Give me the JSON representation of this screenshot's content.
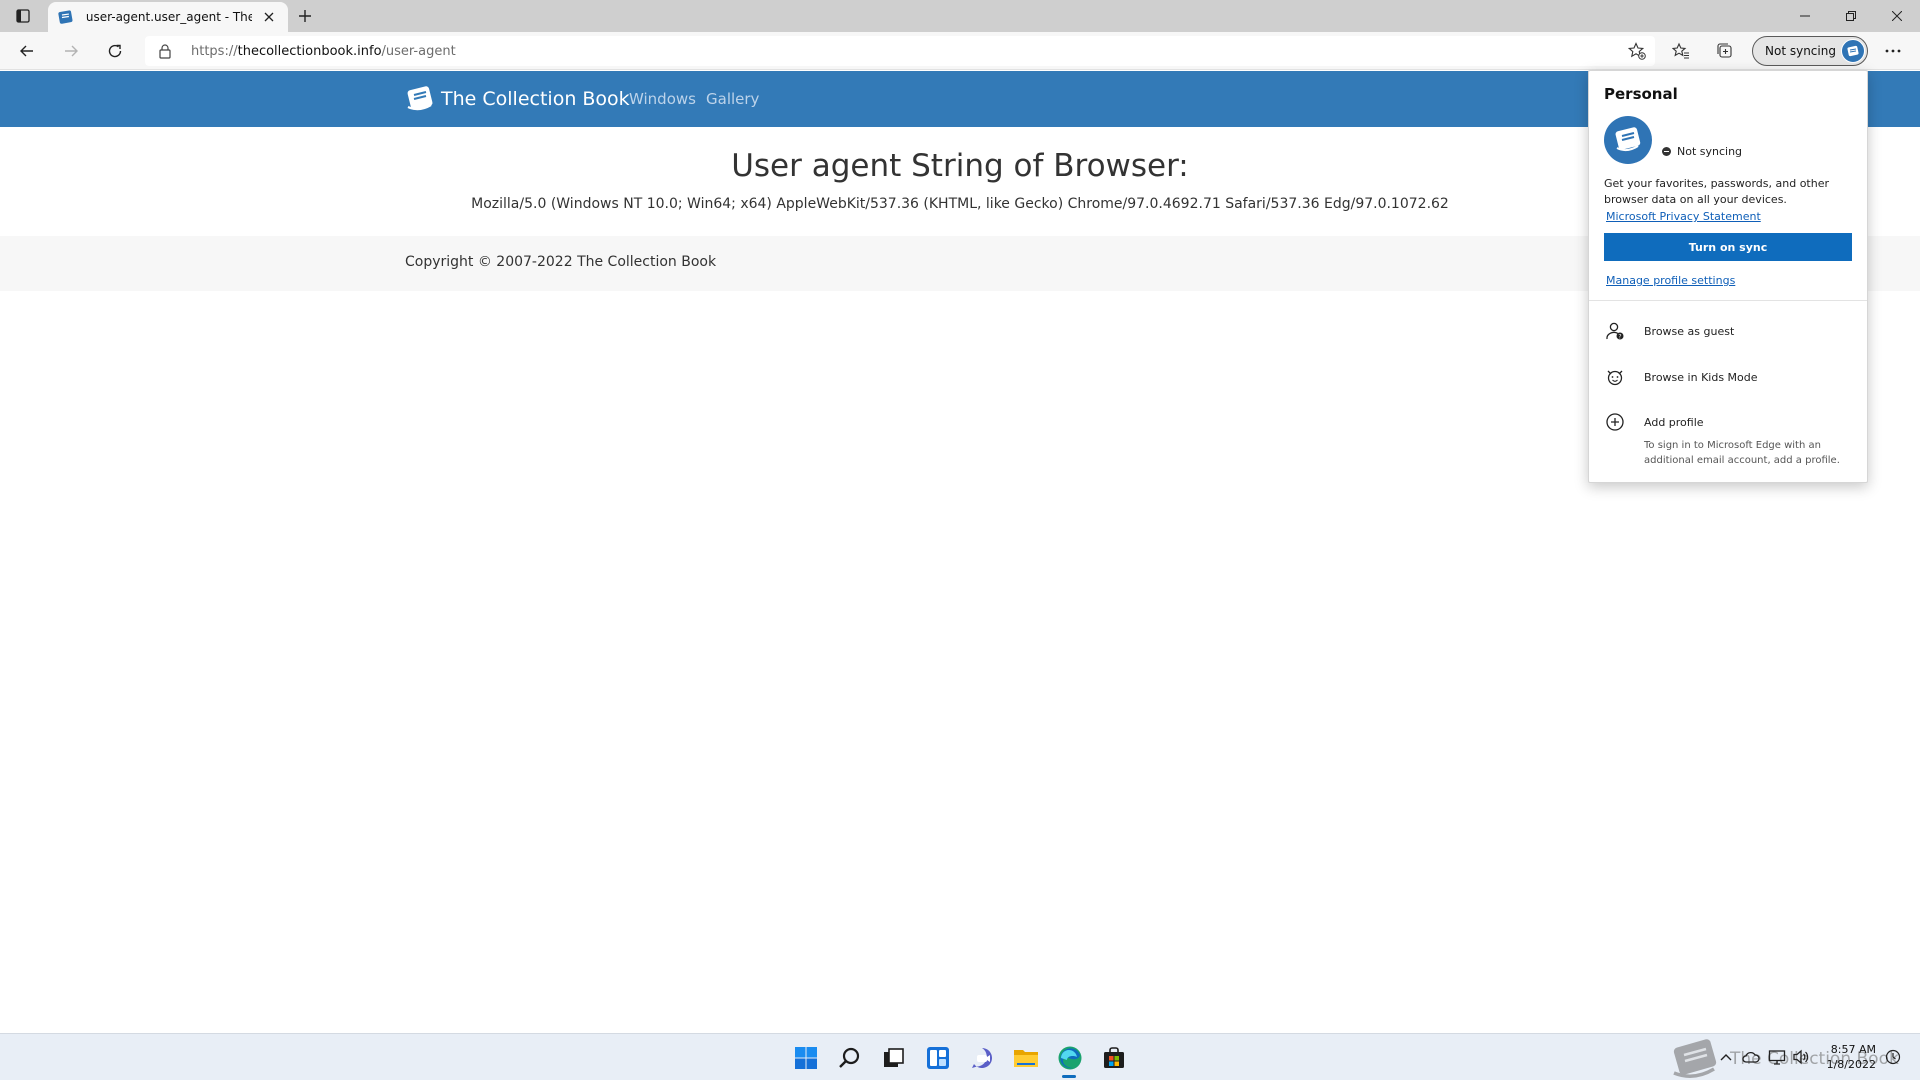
{
  "browser": {
    "tab_title": "user-agent.user_agent - The Coll",
    "url_prefix": "https://",
    "url_host": "thecollectionbook.info",
    "url_path": "/user-agent",
    "profile_button_label": "Not syncing"
  },
  "site": {
    "brand": "The Collection Book",
    "nav": [
      "Windows",
      "Gallery"
    ],
    "heading": "User agent String of Browser:",
    "user_agent": "Mozilla/5.0 (Windows NT 10.0; Win64; x64) AppleWebKit/537.36 (KHTML, like Gecko) Chrome/97.0.4692.71 Safari/537.36 Edg/97.0.1072.62",
    "copyright": "Copyright © 2007-2022 The Collection Book"
  },
  "flyout": {
    "title": "Personal",
    "sync_status": "Not syncing",
    "description": "Get your favorites, passwords, and other browser data on all your devices.",
    "privacy_link": "Microsoft Privacy Statement",
    "sync_button": "Turn on sync",
    "manage_link": "Manage profile settings",
    "items": [
      {
        "label": "Browse as guest",
        "icon": "guest-icon"
      },
      {
        "label": "Browse in Kids Mode",
        "icon": "kids-mode-icon"
      },
      {
        "label": "Add profile",
        "icon": "add-circle-icon"
      }
    ],
    "add_profile_hint": "To sign in to Microsoft Edge with an additional email account, add a profile."
  },
  "taskbar": {
    "time": "8:57 AM",
    "date": "1/8/2022",
    "watermark": "The Collection Book"
  },
  "colors": {
    "site_nav": "#337ab7",
    "accent": "#0f6cbd",
    "tabstrip": "#cfcfcf",
    "taskbar": "#e8eef6"
  }
}
